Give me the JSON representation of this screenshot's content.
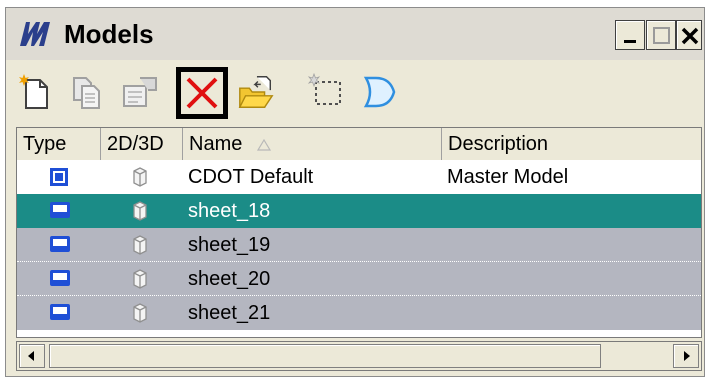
{
  "window": {
    "title": "Models"
  },
  "toolbar": {
    "buttons": [
      {
        "name": "create-model",
        "icon": "new-document-icon"
      },
      {
        "name": "copy-model",
        "icon": "copy-document-icon"
      },
      {
        "name": "model-properties",
        "icon": "properties-icon"
      },
      {
        "name": "delete-model",
        "icon": "red-x-icon",
        "selected": true
      },
      {
        "name": "import-model",
        "icon": "open-folder-icon"
      },
      {
        "name": "create-model-from-fence",
        "icon": "fence-selection-icon"
      },
      {
        "name": "filter",
        "icon": "funnel-icon"
      }
    ]
  },
  "table": {
    "columns": [
      "Type",
      "2D/3D",
      "Name",
      "Description"
    ],
    "rows": [
      {
        "type": "master-model",
        "name": "CDOT Default",
        "description": "Master Model",
        "state": "master"
      },
      {
        "type": "sheet",
        "name": "sheet_18",
        "description": "",
        "state": "selected"
      },
      {
        "type": "sheet",
        "name": "sheet_19",
        "description": "",
        "state": "sheet"
      },
      {
        "type": "sheet",
        "name": "sheet_20",
        "description": "",
        "state": "sheet"
      },
      {
        "type": "sheet",
        "name": "sheet_21",
        "description": "",
        "state": "sheet"
      }
    ]
  },
  "colors": {
    "selected_row": "#1b8c87",
    "sheet_row": "#b4b6c0",
    "type_icon": "#1f4fd6",
    "delete_red": "#e01010"
  }
}
